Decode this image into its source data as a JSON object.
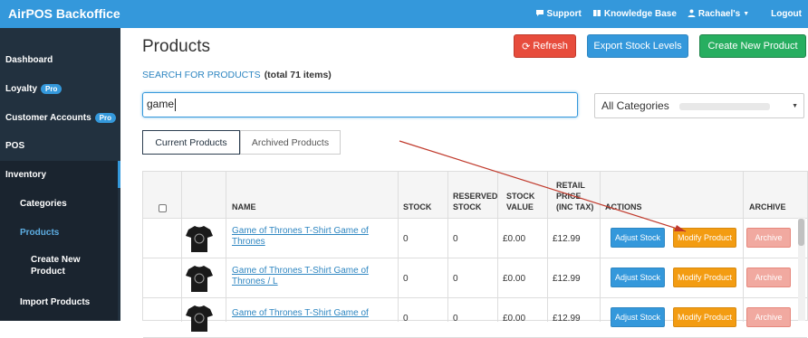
{
  "app": {
    "title": "AirPOS Backoffice"
  },
  "topnav": {
    "support": "Support",
    "knowledge": "Knowledge Base",
    "user": "Rachael's",
    "logout": "Logout"
  },
  "sidebar": {
    "dashboard": "Dashboard",
    "loyalty": "Loyalty",
    "customer_accounts": "Customer Accounts",
    "pro": "Pro",
    "pos": "POS",
    "inventory": "Inventory",
    "categories": "Categories",
    "products": "Products",
    "create_new_1": "Create New",
    "create_new_2": "Product",
    "import_products": "Import Products"
  },
  "page": {
    "title": "Products",
    "refresh": "Refresh",
    "export": "Export Stock Levels",
    "create": "Create New Product",
    "search_label": "SEARCH FOR PRODUCTS",
    "total": "(total 71 items)",
    "search_value": "game",
    "category": "All Categories",
    "tab_current": "Current Products",
    "tab_archived": "Archived Products"
  },
  "table": {
    "headers": {
      "name": "NAME",
      "stock": "STOCK",
      "reserved_1": "RESERVED",
      "reserved_2": "STOCK",
      "stock_value_1": "STOCK",
      "stock_value_2": "VALUE",
      "retail_1": "RETAIL",
      "retail_2": "PRICE",
      "retail_3": "(INC TAX)",
      "actions": "ACTIONS",
      "archive": "ARCHIVE"
    },
    "rows": [
      {
        "name_1": "Game of Thrones T-Shirt Game of",
        "name_2": "Thrones",
        "stock": "0",
        "reserved": "0",
        "value": "£0.00",
        "price": "£12.99"
      },
      {
        "name_1": "Game of Thrones T-Shirt Game of",
        "name_2": "Thrones / L",
        "stock": "0",
        "reserved": "0",
        "value": "£0.00",
        "price": "£12.99"
      },
      {
        "name_1": "Game of Thrones T-Shirt Game of",
        "name_2": "",
        "stock": "0",
        "reserved": "0",
        "value": "£0.00",
        "price": "£12.99"
      }
    ],
    "actions": {
      "adjust": "Adjust Stock",
      "modify": "Modify Product",
      "archive": "Archive"
    }
  },
  "colors": {
    "brand": "#3498db",
    "sidebar": "#22313f",
    "refresh": "#e74c3c",
    "create": "#27ae60",
    "modify": "#f39c12",
    "annotation_arrow": "#c0392b"
  }
}
